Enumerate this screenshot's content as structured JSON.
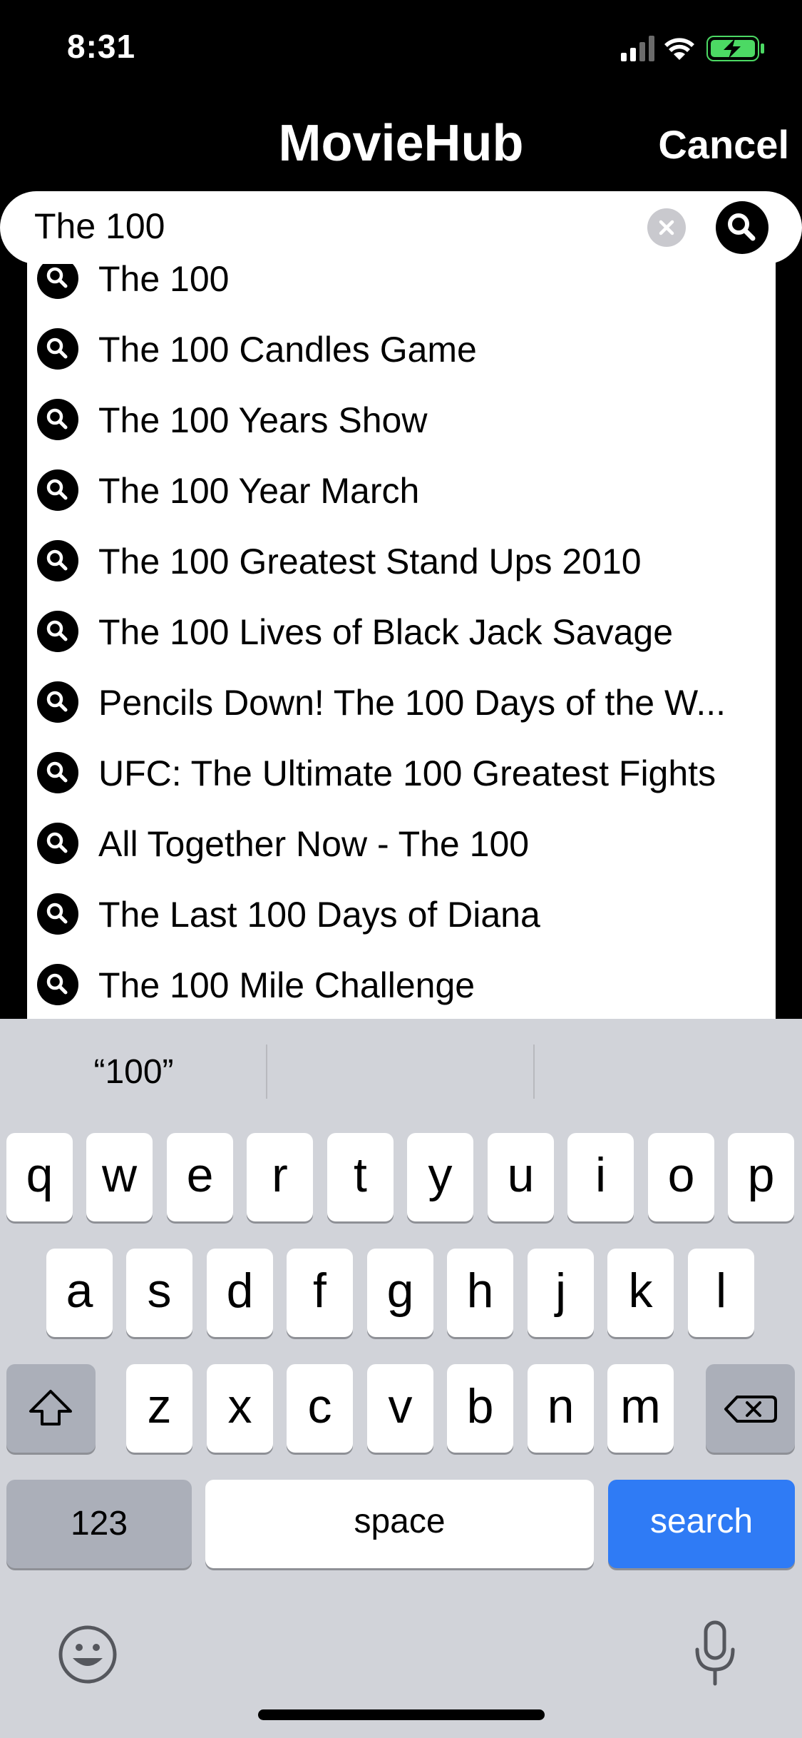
{
  "status": {
    "time": "8:31"
  },
  "nav": {
    "title": "MovieHub",
    "cancel": "Cancel"
  },
  "search": {
    "query": "The 100"
  },
  "suggestions": [
    "The 100",
    "The 100 Candles Game",
    "The 100 Years Show",
    "The 100 Year March",
    "The 100 Greatest Stand Ups 2010",
    "The 100 Lives of Black Jack Savage",
    "Pencils Down! The 100 Days of the W...",
    "UFC: The Ultimate 100 Greatest Fights",
    "All Together Now - The 100",
    "The Last 100 Days of Diana",
    "The 100 Mile Challenge"
  ],
  "keyboard": {
    "predictions": [
      "“100”",
      "",
      ""
    ],
    "row1": [
      "q",
      "w",
      "e",
      "r",
      "t",
      "y",
      "u",
      "i",
      "o",
      "p"
    ],
    "row2": [
      "a",
      "s",
      "d",
      "f",
      "g",
      "h",
      "j",
      "k",
      "l"
    ],
    "row3": [
      "z",
      "x",
      "c",
      "v",
      "b",
      "n",
      "m"
    ],
    "numbers": "123",
    "space": "space",
    "search": "search"
  },
  "colors": {
    "accent": "#2f7bf5",
    "keyboard_bg": "#d1d3d9",
    "dark_key": "#abafb9",
    "battery": "#4cd964"
  },
  "icons": [
    "signal-icon",
    "wifi-icon",
    "battery-charging-icon",
    "clear-icon",
    "search-icon",
    "shift-icon",
    "delete-icon",
    "emoji-icon",
    "microphone-icon"
  ]
}
